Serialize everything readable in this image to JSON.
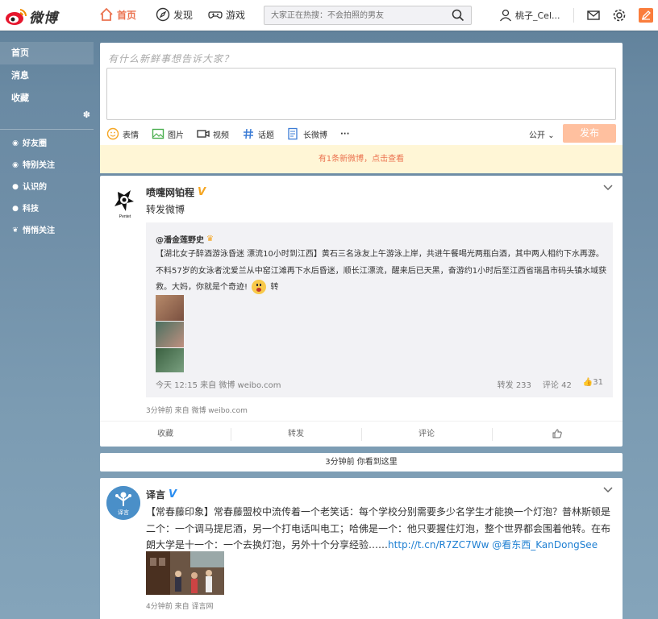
{
  "topbar": {
    "logo_text": "微博",
    "nav_home": "首页",
    "nav_discover": "发现",
    "nav_game": "游戏",
    "search_placeholder": "大家正在热搜：不会拍照的男友",
    "username": "桃子_Cel..."
  },
  "sidebar": {
    "items": [
      "首页",
      "消息",
      "收藏"
    ],
    "groups": [
      "好友圈",
      "特别关注",
      "认识的",
      "科技",
      "悄悄关注"
    ]
  },
  "composer": {
    "prompt": "有什么新鲜事想告诉大家？",
    "tools": [
      "表情",
      "图片",
      "视频",
      "话题",
      "长微博",
      "···"
    ],
    "privacy": "公开",
    "publish": "发布",
    "new_notice": "有1条新微博，点击查看"
  },
  "post1": {
    "author": "喷嚏网铂程",
    "text": "转发微博",
    "repost_author": "@潘金莲野史",
    "repost_text_1": "【湖北女子醉酒游泳昏迷 漂流10小时到江西】黄石三名泳友上午游泳上岸，共进午餐喝光两瓶白酒，其中两人相约下水再游。不料57岁的女泳者沈爱兰从中窑江滩再下水后昏迷，顺长江漂流，醒来后已天黑，奋游约1小时后至江西省瑞昌市码头镇水域获救。大妈，你就是个奇迹!",
    "repost_text_2": "转",
    "repost_time": "今天 12:15 来自 微博 weibo.com",
    "repost_stats": {
      "forward": "转发 233",
      "comment": "评论 42",
      "like": "31"
    },
    "meta": "3分钟前 来自 微博 weibo.com",
    "actions": [
      "收藏",
      "转发",
      "评论"
    ]
  },
  "seen_notice": "3分钟前 你看到这里",
  "post2": {
    "author": "译言",
    "avatar_label": "译言",
    "text": "【常春藤印象】常春藤盟校中流传着一个老笑话：每个学校分别需要多少名学生才能换一个灯泡？普林斯顿是二个：一个调马提尼酒，另一个打电话叫电工；哈佛是一个：他只要握住灯泡，整个世界都会围着他转。在布朗大学是十一个：一个去换灯泡，另外十个分享经验……",
    "link1": "http://t.cn/R7ZC7Ww",
    "link2": "@看东西_KanDongSee",
    "meta": "4分钟前 来自 译言网"
  }
}
